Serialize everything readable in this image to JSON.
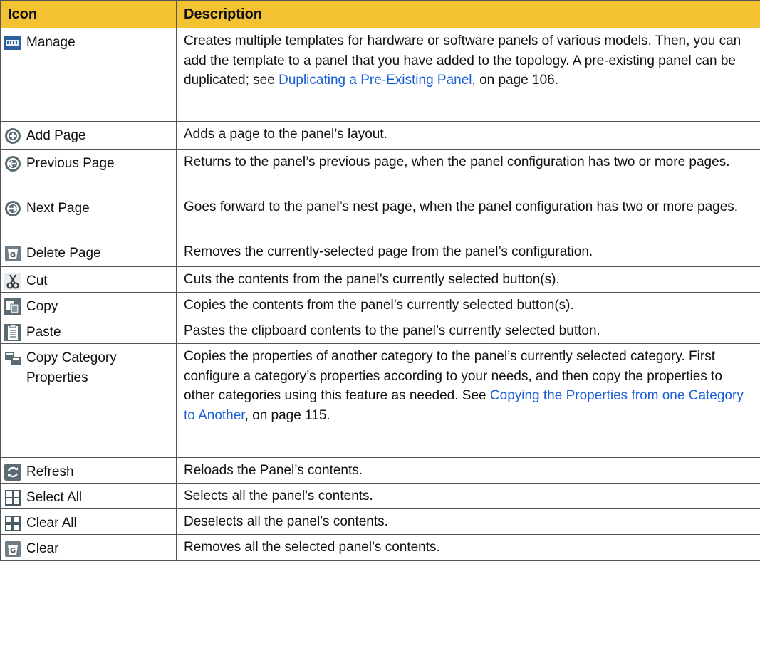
{
  "table": {
    "headers": {
      "icon": "Icon",
      "description": "Description"
    },
    "rows": [
      {
        "icon": "manage-icon",
        "label": "Manage",
        "desc": "Creates multiple templates for hardware or software panels of various models. Then, you can add the template to a panel that you have added to the topology. A pre-existing panel can be duplicated; see ",
        "link": "Duplicating a Pre-Existing Panel",
        "after": ", on page 106."
      },
      {
        "icon": "add-page-icon",
        "label": "Add Page",
        "desc": "Adds a page to the panel’s layout."
      },
      {
        "icon": "previous-page-icon",
        "label": "Previous Page",
        "desc": "Returns to the panel’s previous page, when the panel configuration has two or more pages."
      },
      {
        "icon": "next-page-icon",
        "label": "Next Page",
        "desc": "Goes forward to the panel’s nest page, when the panel configuration has two or more pages."
      },
      {
        "icon": "delete-page-icon",
        "label": "Delete Page",
        "desc": "Removes the currently-selected page from the panel’s configuration."
      },
      {
        "icon": "cut-icon",
        "label": "Cut",
        "desc": "Cuts the contents from the panel’s currently selected button(s)."
      },
      {
        "icon": "copy-icon",
        "label": "Copy",
        "desc": "Copies the contents from the panel’s currently selected button(s)."
      },
      {
        "icon": "paste-icon",
        "label": "Paste",
        "desc": "Pastes the clipboard contents to the panel’s currently selected button."
      },
      {
        "icon": "copy-category-properties-icon",
        "label": "Copy Category Properties",
        "desc": "Copies the properties of another category to the panel’s currently selected category. First configure a category’s properties according to your needs, and then copy the properties to other categories using this feature as needed. See ",
        "link": "Copying the Properties from one Category to Another",
        "after": ", on page 115."
      },
      {
        "icon": "refresh-icon",
        "label": "Refresh",
        "desc": "Reloads the Panel’s contents."
      },
      {
        "icon": "select-all-icon",
        "label": "Select All",
        "desc": "Selects all the panel’s contents."
      },
      {
        "icon": "clear-all-icon",
        "label": "Clear All",
        "desc": "Deselects all the panel’s contents."
      },
      {
        "icon": "clear-icon",
        "label": "Clear",
        "desc": "Removes all the selected panel’s contents."
      }
    ]
  },
  "colors": {
    "header_bg": "#f2c232",
    "link": "#1a5fd6",
    "border": "#555555"
  }
}
